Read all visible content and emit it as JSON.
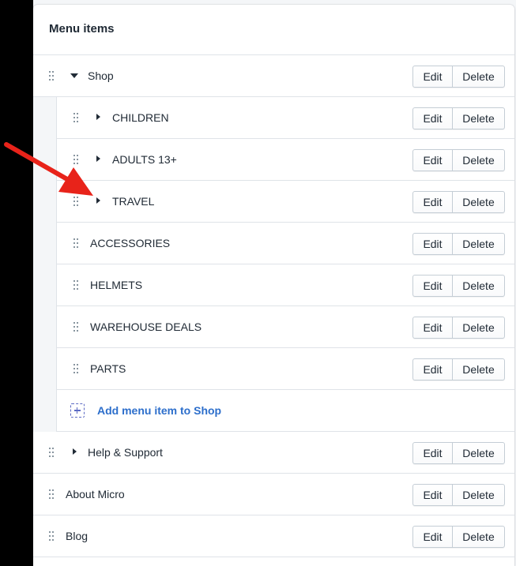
{
  "header": {
    "title": "Menu items"
  },
  "buttons": {
    "edit": "Edit",
    "delete": "Delete"
  },
  "items": [
    {
      "label": "Shop"
    },
    {
      "label": "CHILDREN"
    },
    {
      "label": "ADULTS 13+"
    },
    {
      "label": "TRAVEL"
    },
    {
      "label": "ACCESSORIES"
    },
    {
      "label": "HELMETS"
    },
    {
      "label": "WAREHOUSE DEALS"
    },
    {
      "label": "PARTS"
    },
    {
      "label": "Help & Support"
    },
    {
      "label": "About Micro"
    },
    {
      "label": "Blog"
    }
  ],
  "add_link": "Add menu item to Shop",
  "annotation": {
    "arrow_color": "#e8231a"
  },
  "colors": {
    "link": "#2c6ecb",
    "add_icon": "#5c6ac4",
    "border": "#dfe3e8"
  }
}
